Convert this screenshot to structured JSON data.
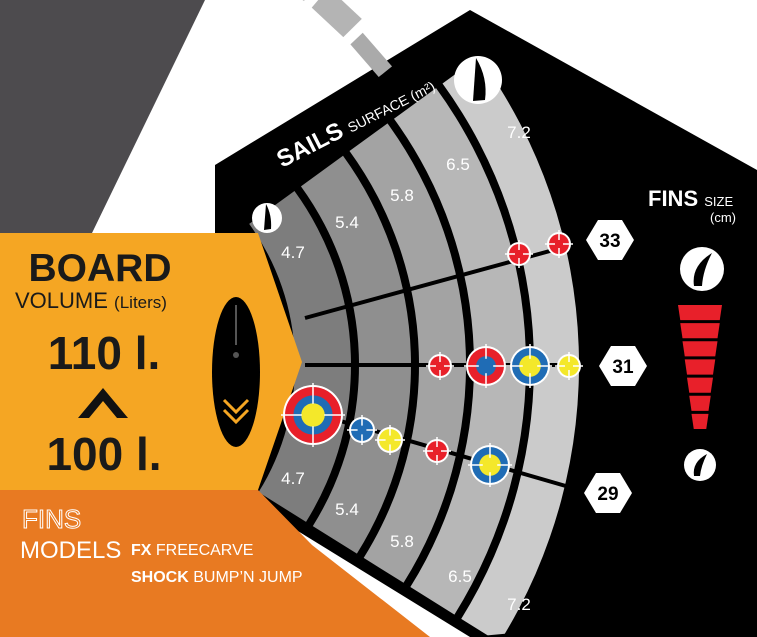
{
  "board": {
    "title": "BOARD",
    "volume_label": "VOLUME",
    "volume_unit": "(Liters)",
    "volume_max": "110 l.",
    "volume_min": "100 l."
  },
  "sails": {
    "title": "SAILS",
    "subtitle": "SURFACE (m²)",
    "sizes": [
      "4.7",
      "5.4",
      "5.8",
      "6.5",
      "7.2"
    ]
  },
  "fins_size": {
    "title": "FINS",
    "subtitle": "SIZE",
    "unit": "(cm)",
    "sizes": [
      "33",
      "31",
      "29"
    ]
  },
  "fins_models": {
    "title_line1": "FINS",
    "title_line2": "MODELS",
    "models": [
      {
        "code": "FX",
        "name": "FREECARVE"
      },
      {
        "code": "SHOCK",
        "name": "BUMP’N JUMP"
      }
    ]
  },
  "colors": {
    "background_stripe": "#4d4b4e",
    "hexagon": "#000000",
    "board_panel": "#f5a623",
    "fins_panel": "#e87a22",
    "sector_band_1": "#7d7d7d",
    "sector_band_2": "#8f8f8f",
    "sector_band_3": "#a3a3a3",
    "sector_band_4": "#b7b7b7",
    "sector_band_5": "#cbcbcb",
    "marker_red": "#e8202a",
    "marker_blue": "#1f6cb5",
    "marker_yellow": "#f4e82a",
    "fin_bar_red": "#e8202a"
  },
  "icons": [
    "sail-small-icon",
    "sail-large-icon",
    "board-icon",
    "fin-large-icon",
    "fin-small-icon"
  ]
}
